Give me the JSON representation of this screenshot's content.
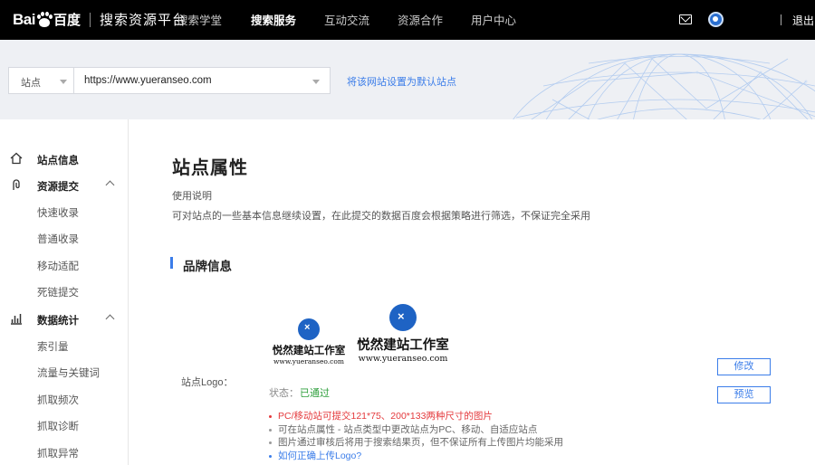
{
  "header": {
    "logo_bai": "Bai",
    "logo_du": "百度",
    "platform_title": "搜索资源平台",
    "nav": [
      {
        "label": "搜索学堂",
        "active": false
      },
      {
        "label": "搜索服务",
        "active": true
      },
      {
        "label": "互动交流",
        "active": false
      },
      {
        "label": "资源合作",
        "active": false
      },
      {
        "label": "用户中心",
        "active": false
      }
    ],
    "icons": {
      "mail": "mail-icon",
      "avatar": "user-avatar"
    },
    "logout": "退出"
  },
  "site_bar": {
    "site_type": "站点",
    "site_url": "https://www.yueranseo.com",
    "set_default_link": "将该网站设置为默认站点"
  },
  "sidebar": {
    "groups": [
      {
        "label": "站点信息",
        "icon": "home-icon",
        "items": []
      },
      {
        "label": "资源提交",
        "icon": "submit-icon",
        "expanded": true,
        "items": [
          "快速收录",
          "普通收录",
          "移动适配",
          "死链提交"
        ]
      },
      {
        "label": "数据统计",
        "icon": "stats-icon",
        "expanded": true,
        "items": [
          "索引量",
          "流量与关键词",
          "抓取频次",
          "抓取诊断",
          "抓取异常"
        ]
      }
    ]
  },
  "main": {
    "title": "站点属性",
    "usage_label": "使用说明",
    "usage_text": "可对站点的一些基本信息继续设置，在此提交的数据百度会根据策略进行筛选，不保证完全采用",
    "section_title": "品牌信息",
    "logo_field": {
      "label": "站点Logo：",
      "brand_name": "悦然建站工作室",
      "brand_url": "www.yueranseo.com",
      "status_label": "状态：",
      "status_value": "已通过",
      "notes": [
        "PC/移动站可提交121*75、200*133两种尺寸的图片",
        "可在站点属性 - 站点类型中更改站点为PC、移动、自适应站点",
        "图片通过审核后将用于搜索结果页，但不保证所有上传图片均能采用",
        "如何正确上传Logo?"
      ],
      "buttons": {
        "modify": "修改",
        "preview": "预览"
      }
    }
  },
  "colors": {
    "accent": "#3b7de9",
    "success": "#2e9f3c",
    "warning": "#e4393c",
    "topbar": "#000000"
  }
}
